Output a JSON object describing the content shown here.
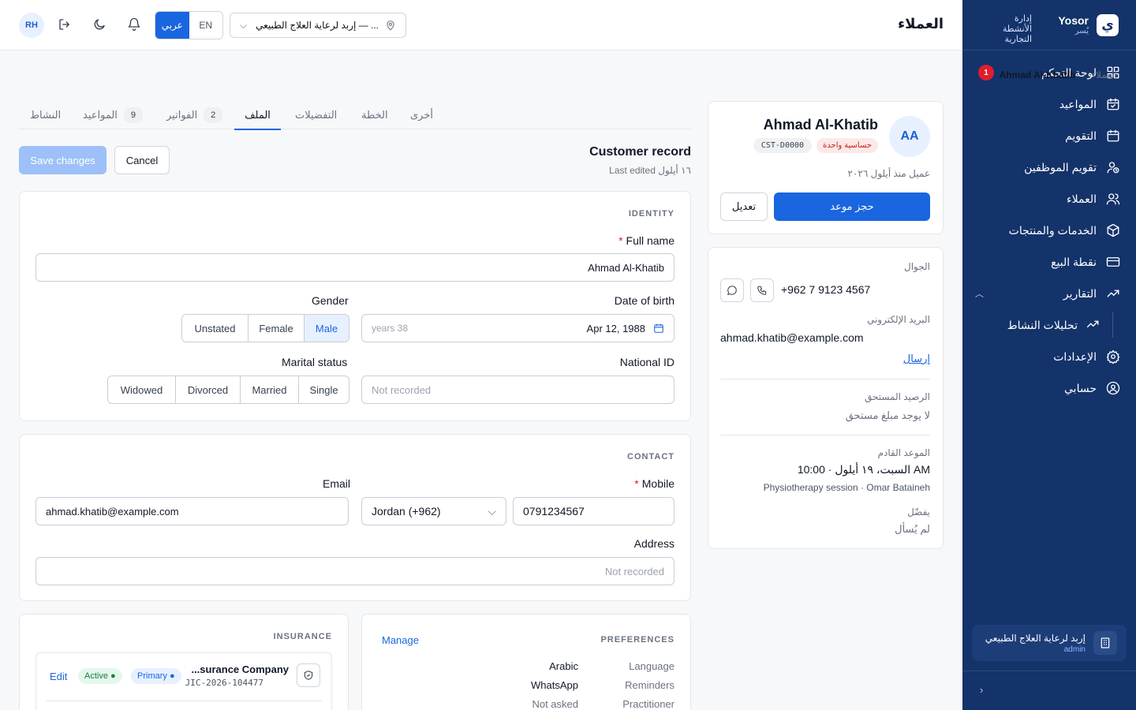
{
  "sidebar": {
    "brand_name": "Yosor",
    "brand_sub": "يُسر",
    "brand_logo": "ي",
    "brand_desc": "إدارة الأنشطة التجارية",
    "items": [
      {
        "label": "لوحة التحكم",
        "icon": "dashboard-icon",
        "badge": "1"
      },
      {
        "label": "المواعيد",
        "icon": "calendar-check-icon"
      },
      {
        "label": "التقويم",
        "icon": "calendar-icon"
      },
      {
        "label": "تقويم الموظفين",
        "icon": "user-clock-icon"
      },
      {
        "label": "العملاء",
        "icon": "users-icon"
      },
      {
        "label": "الخدمات والمنتجات",
        "icon": "box-icon"
      },
      {
        "label": "نقطة البيع",
        "icon": "card-icon"
      },
      {
        "label": "التقارير",
        "icon": "trend-icon"
      },
      {
        "label": "تحليلات النشاط",
        "icon": "trend-icon"
      },
      {
        "label": "الإعدادات",
        "icon": "gear-icon"
      },
      {
        "label": "حسابي",
        "icon": "user-circle-icon"
      }
    ],
    "clinic": {
      "name": "إربد لرعاية العلاج الطبيعي",
      "role": "admin"
    },
    "collapse": "›"
  },
  "topbar": {
    "title": "العملاء",
    "avatar": "RH",
    "lang_ar": "عربي",
    "lang_en": "EN",
    "clinic_select": "إربد لرعاية العلاج الطبيعي — ..."
  },
  "breadcrumb": {
    "root": "العملاء",
    "sep": "›",
    "current": "Ahmad Al-Khatib"
  },
  "profile": {
    "initials": "AA",
    "name": "Ahmad Al-Khatib",
    "tag": "حساسية واحدة",
    "id": "CST-D0000",
    "since": "عميل منذ أيلول ٢٠٢٦",
    "book": "حجز موعد",
    "edit": "تعديل"
  },
  "contact_card": {
    "mobile_label": "الجوال",
    "mobile": "+962 7 9123 4567",
    "email_label": "البريد الإلكتروني",
    "email": "ahmad.khatib@example.com",
    "send": "إرسال",
    "balance_label": "الرصيد المستحق",
    "balance": "لا يوجد مبلغ مستحق",
    "next_label": "الموعد القادم",
    "next_time": "السبت، ١٩ أيلول · 10:00 AM",
    "next_detail": "Physiotherapy session · Omar Bataineh",
    "pref_label": "يفضّل",
    "pref_value": "لم يُسأل"
  },
  "tabs": [
    {
      "label": "أخرى"
    },
    {
      "label": "الخطة"
    },
    {
      "label": "التفضيلات"
    },
    {
      "label": "الملف"
    },
    {
      "label": "الفواتير",
      "count": "2"
    },
    {
      "label": "المواعيد",
      "count": "9"
    },
    {
      "label": "النشاط"
    }
  ],
  "record": {
    "title": "Customer record",
    "last_edited": "Last edited ١٦ أيلول",
    "save": "Save changes",
    "cancel": "Cancel"
  },
  "identity": {
    "title": "IDENTITY",
    "fullname_label": "Full name",
    "fullname": "Ahmad Al-Khatib",
    "gender_label": "Gender",
    "gender_options": [
      "Unstated",
      "Female",
      "Male"
    ],
    "gender_selected": "Male",
    "dob_label": "Date of birth",
    "dob": "Apr 12, 1988",
    "age": "years 38",
    "marital_label": "Marital status",
    "marital_options": [
      "Widowed",
      "Divorced",
      "Married",
      "Single"
    ],
    "nid_label": "National ID",
    "nid_placeholder": "Not recorded"
  },
  "contact": {
    "title": "CONTACT",
    "email_label": "Email",
    "email": "ahmad.khatib@example.com",
    "mobile_label": "Mobile",
    "country": "Jordan (+962)",
    "mobile": "0791234567",
    "address_label": "Address",
    "address_placeholder": "Not recorded"
  },
  "insurance": {
    "title": "INSURANCE",
    "company": "...surance Company",
    "policy": "JIC-2026-104477",
    "primary": "Primary",
    "active": "Active",
    "edit": "Edit"
  },
  "preferences": {
    "title": "PREFERENCES",
    "manage": "Manage",
    "rows": [
      {
        "key": "Language",
        "value": "Arabic"
      },
      {
        "key": "Reminders",
        "value": "WhatsApp"
      },
      {
        "key": "Practitioner",
        "value": "Not asked"
      }
    ]
  }
}
